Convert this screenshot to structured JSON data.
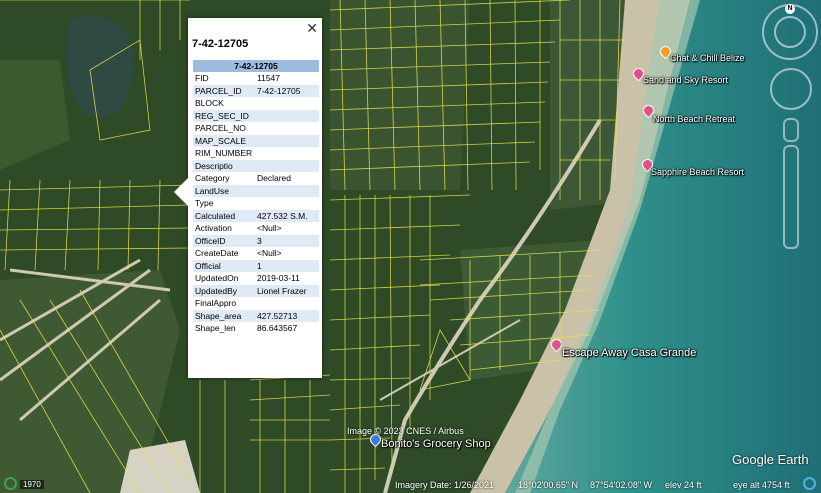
{
  "map": {
    "colors": {
      "vegetation": "#2c4a23",
      "sea": "#2f8f8a",
      "beach": "#c9c1a8",
      "parcel_lines": "#e6e04a"
    },
    "places": [
      {
        "name": "Chat & Chill Belize",
        "pin_color": "orange"
      },
      {
        "name": "Sand and Sky Resort",
        "pin_color": "pink"
      },
      {
        "name": "North Beach Retreat",
        "pin_color": "pink"
      },
      {
        "name": "Sapphire Beach Resort",
        "pin_color": "pink"
      },
      {
        "name": "Escape Away Casa Grande",
        "pin_color": "pink"
      },
      {
        "name": "Bonito's Grocery Shop",
        "pin_color": "blue"
      }
    ],
    "attribution": "Image © 2023 CNES / Airbus",
    "logo": "Google Earth",
    "compass_letter": "N"
  },
  "popup": {
    "title": "7-42-12705",
    "table_header": "7-42-12705",
    "rows": [
      {
        "key": "FID",
        "value": "11547"
      },
      {
        "key": "PARCEL_ID",
        "value": "7-42-12705"
      },
      {
        "key": "BLOCK",
        "value": ""
      },
      {
        "key": "REG_SEC_ID",
        "value": ""
      },
      {
        "key": "PARCEL_NO",
        "value": ""
      },
      {
        "key": "MAP_SCALE",
        "value": ""
      },
      {
        "key": "RIM_NUMBER",
        "value": ""
      },
      {
        "key": "Descriptio",
        "value": ""
      },
      {
        "key": "Category",
        "value": "Declared"
      },
      {
        "key": "LandUse",
        "value": ""
      },
      {
        "key": "Type",
        "value": ""
      },
      {
        "key": "Calculated",
        "value": "427.532 S.M."
      },
      {
        "key": "Activation",
        "value": "<Null>"
      },
      {
        "key": "OfficeID",
        "value": "3"
      },
      {
        "key": "CreateDate",
        "value": "<Null>"
      },
      {
        "key": "Official",
        "value": "1"
      },
      {
        "key": "UpdatedOn",
        "value": "2019-03-11"
      },
      {
        "key": "UpdatedBy",
        "value": "Lionel Frazer"
      },
      {
        "key": "FinalAppro",
        "value": ""
      },
      {
        "key": "Shape_area",
        "value": "427.52713"
      },
      {
        "key": "Shape_len",
        "value": "86.643567"
      }
    ],
    "close_label": "✕"
  },
  "statusbar": {
    "year": "1970",
    "imagery_date": "Imagery Date: 1/26/2021",
    "latitude": "18°02'00.65\" N",
    "longitude": "87°54'02.08\" W",
    "elevation": "elev   24 ft",
    "eye_alt": "eye alt   4754 ft"
  }
}
